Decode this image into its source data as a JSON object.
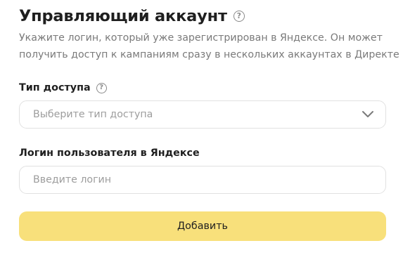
{
  "header": {
    "title": "Управляющий аккаунт",
    "help_icon_glyph": "?",
    "description_line1": "Укажите логин, который уже зарегистрирован в Яндексе. Он может",
    "description_line2": "получить доступ к кампаниям сразу в нескольких аккаунтах в Директе"
  },
  "access_type": {
    "label": "Тип доступа",
    "help_icon_glyph": "?",
    "placeholder": "Выберите тип доступа",
    "icon": "chevron-down-icon"
  },
  "login": {
    "label": "Логин пользователя в Яндексе",
    "placeholder": "Введите логин",
    "value": ""
  },
  "submit": {
    "label": "Добавить",
    "color": "#f8e07b"
  },
  "colors": {
    "text": "#1f1f1f",
    "muted": "#7a7a7a",
    "placeholder": "#9d9d9d",
    "border": "#e1e1e1"
  }
}
